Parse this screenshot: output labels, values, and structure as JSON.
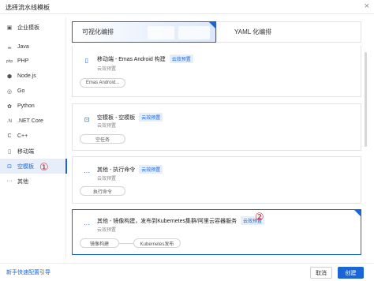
{
  "dialog": {
    "title": "选择流水线模板",
    "close_icon": "close-icon"
  },
  "sidebar": {
    "items": [
      {
        "label": "企业模板",
        "icon": "enterprise-template-icon",
        "glyph": "▣"
      },
      {
        "label": "Java",
        "icon": "java-icon",
        "glyph": "☕"
      },
      {
        "label": "PHP",
        "icon": "php-icon",
        "glyph": "php"
      },
      {
        "label": "Node.js",
        "icon": "nodejs-icon",
        "glyph": "⬢"
      },
      {
        "label": "Go",
        "icon": "go-icon",
        "glyph": "◎"
      },
      {
        "label": "Python",
        "icon": "python-icon",
        "glyph": "✿"
      },
      {
        "label": ".NET Core",
        "icon": "dotnet-icon",
        "glyph": ".N"
      },
      {
        "label": "C++",
        "icon": "cpp-icon",
        "glyph": "C"
      },
      {
        "label": "移动端",
        "icon": "mobile-icon",
        "glyph": "▯"
      },
      {
        "label": "空模板",
        "icon": "empty-template-icon",
        "glyph": "⊡"
      },
      {
        "label": "其他",
        "icon": "more-icon",
        "glyph": "···"
      }
    ],
    "active_index": 9,
    "marker": "①"
  },
  "tabs": [
    {
      "label": "可视化编排",
      "selected": true
    },
    {
      "label": "YAML 化编排",
      "selected": false
    }
  ],
  "cards": [
    {
      "title": "移动端 - Emas Android 构建",
      "tag": "云效预置",
      "subtitle": "云效预置",
      "steps": [
        "Emas Android..."
      ],
      "icon": "mobile-icon",
      "glyph": "▯",
      "selected": false
    },
    {
      "title": "空模板 - 空模板",
      "tag": "云效预置",
      "subtitle": "云效预置",
      "steps": [
        "空任务"
      ],
      "icon": "empty-template-icon",
      "glyph": "⊡",
      "selected": false
    },
    {
      "title": "其他 - 执行命令",
      "tag": "云效预置",
      "subtitle": "云效预置",
      "steps": [
        "执行命令"
      ],
      "icon": "more-icon",
      "glyph": "···",
      "selected": false
    },
    {
      "title": "其他 - 镜像构建，发布到Kubernetes集群/阿里云容器服务",
      "tag": "云效预置",
      "subtitle": "云效预置",
      "steps": [
        "镜像构建",
        "Kubernetes发布"
      ],
      "icon": "more-icon",
      "glyph": "···",
      "selected": true,
      "marker": "②"
    }
  ],
  "footer": {
    "guide_link": "新手快速配置引导",
    "cancel_label": "取消",
    "create_label": "创建"
  },
  "colors": {
    "accent": "#1a66d9",
    "annotation": "#d0232a"
  }
}
